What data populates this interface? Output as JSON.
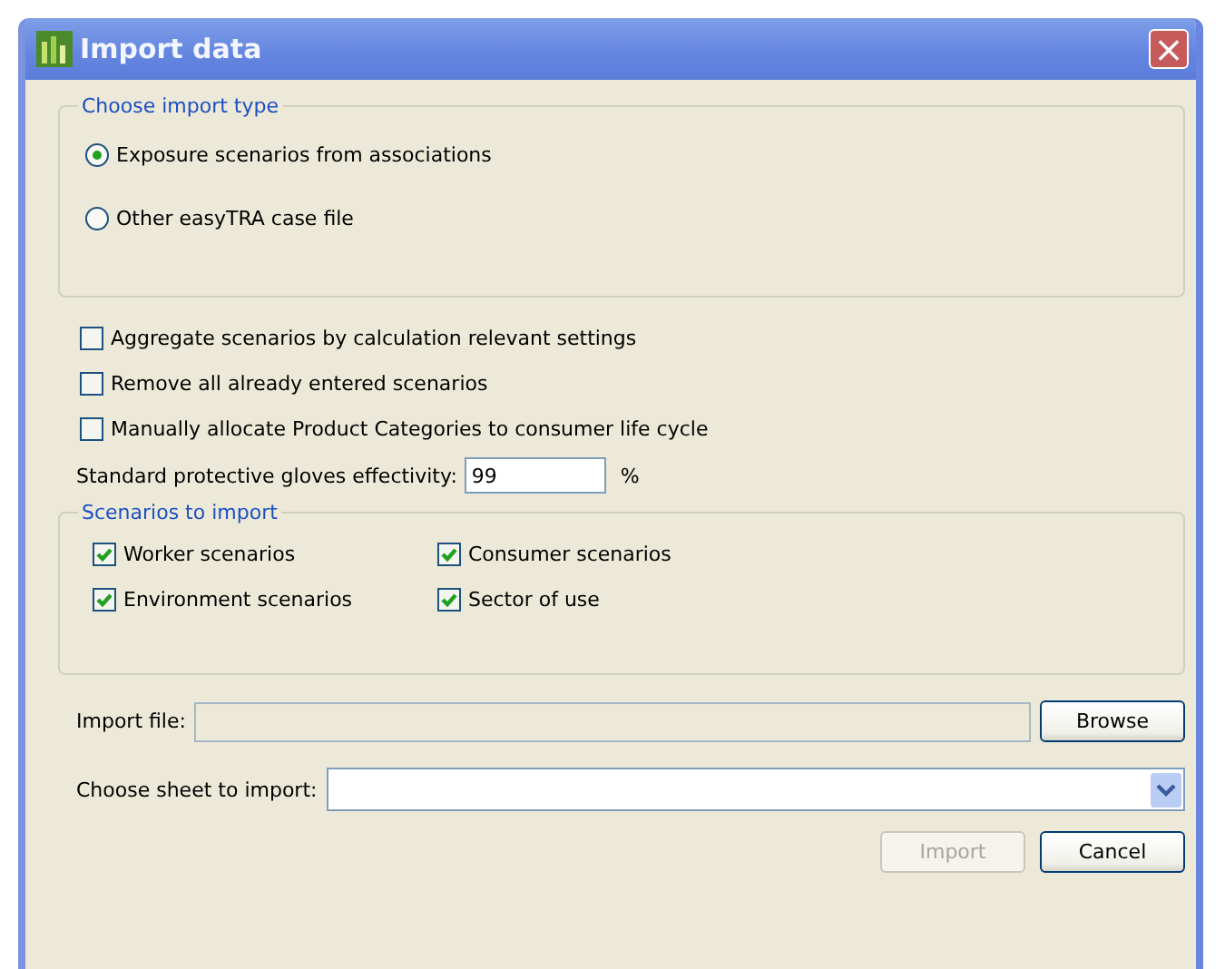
{
  "window": {
    "title": "Import data",
    "close": "×"
  },
  "import_type": {
    "legend": "Choose import type",
    "options": [
      {
        "label": "Exposure scenarios from associations",
        "selected": true
      },
      {
        "label": "Other easyTRA case file",
        "selected": false
      }
    ]
  },
  "options": [
    {
      "label": "Aggregate scenarios by calculation relevant settings",
      "checked": false
    },
    {
      "label": "Remove all already entered scenarios",
      "checked": false
    },
    {
      "label": "Manually allocate Product Categories to consumer life cycle",
      "checked": false
    }
  ],
  "gloves": {
    "label": "Standard protective gloves effectivity:",
    "value": "99",
    "unit": "%"
  },
  "scenarios": {
    "legend": "Scenarios to import",
    "items": [
      {
        "label": "Worker scenarios",
        "checked": true
      },
      {
        "label": "Consumer scenarios",
        "checked": true
      },
      {
        "label": "Environment scenarios",
        "checked": true
      },
      {
        "label": "Sector of use",
        "checked": true
      }
    ]
  },
  "import_file": {
    "label": "Import file:",
    "button": "Browse"
  },
  "sheet": {
    "label": "Choose sheet to import:"
  },
  "buttons": [
    {
      "label": "Import",
      "disabled": true
    },
    {
      "label": "Cancel",
      "disabled": false
    }
  ]
}
